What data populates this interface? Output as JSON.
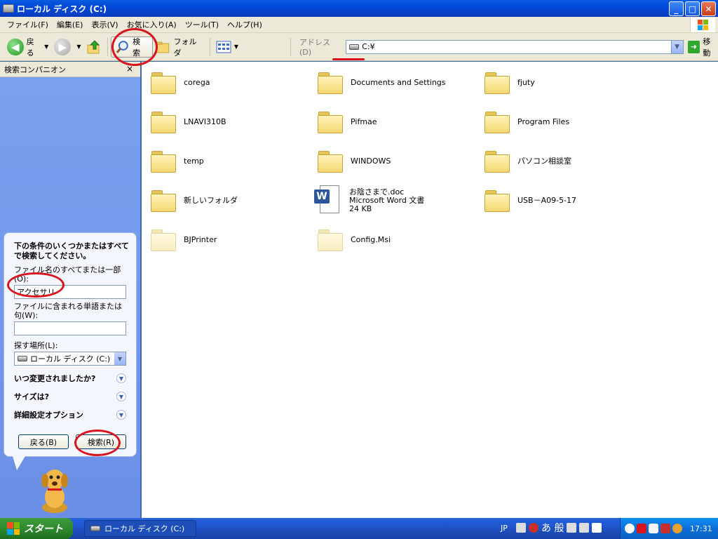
{
  "window": {
    "title": "ローカル ディスク (C:)",
    "buttons": {
      "minimize": "_",
      "maximize": "□",
      "close": "✕"
    }
  },
  "menu": [
    "ファイル(F)",
    "編集(E)",
    "表示(V)",
    "お気に入り(A)",
    "ツール(T)",
    "ヘルプ(H)"
  ],
  "toolbar": {
    "back_label": "戻る",
    "search_label": "検索",
    "folders_label": "フォルダ",
    "address_label": "アドレス(D)",
    "address_value": "C:¥",
    "go_label": "移動"
  },
  "sidebar": {
    "title": "検索コンパニオン",
    "close": "×",
    "prompt": "下の条件のいくつかまたはすべてで検索してください。",
    "filename_label": "ファイル名のすべてまたは一部(O):",
    "filename_value": "アクセサリ",
    "word_label": "ファイルに含まれる単語または句(W):",
    "word_value": "",
    "location_label": "探す場所(L):",
    "location_value": "ローカル ディスク (C:)",
    "options": [
      "いつ変更されましたか?",
      "サイズは?",
      "詳細設定オプション"
    ],
    "back_button": "戻る(B)",
    "search_button": "検索(R)"
  },
  "files": [
    {
      "name": "corega",
      "type": "folder"
    },
    {
      "name": "Documents and Settings",
      "type": "folder"
    },
    {
      "name": "fjuty",
      "type": "folder"
    },
    {
      "name": "LNAVI310B",
      "type": "folder"
    },
    {
      "name": "Pifmae",
      "type": "folder"
    },
    {
      "name": "Program Files",
      "type": "folder"
    },
    {
      "name": "temp",
      "type": "folder"
    },
    {
      "name": "WINDOWS",
      "type": "folder"
    },
    {
      "name": "パソコン相談室",
      "type": "folder"
    },
    {
      "name": "新しいフォルダ",
      "type": "folder"
    },
    {
      "name": "お陰さまで.doc",
      "type": "doc",
      "line2": "Microsoft Word 文書",
      "line3": "24 KB"
    },
    {
      "name": "USB－A09-5-17",
      "type": "folder"
    },
    {
      "name": "BJPrinter",
      "type": "folder-hidden"
    },
    {
      "name": "Config.Msi",
      "type": "folder-hidden"
    }
  ],
  "taskbar": {
    "start_label": "スタート",
    "task_label": "ローカル ディスク (C:)",
    "lang": "JP",
    "ime_text": "あ 般",
    "clock": "17:31"
  },
  "colors": {
    "annotation_red": "#d8141e",
    "titlebar_blue": "#0a5ce0",
    "sidebar_blue": "#7aa2ef"
  }
}
